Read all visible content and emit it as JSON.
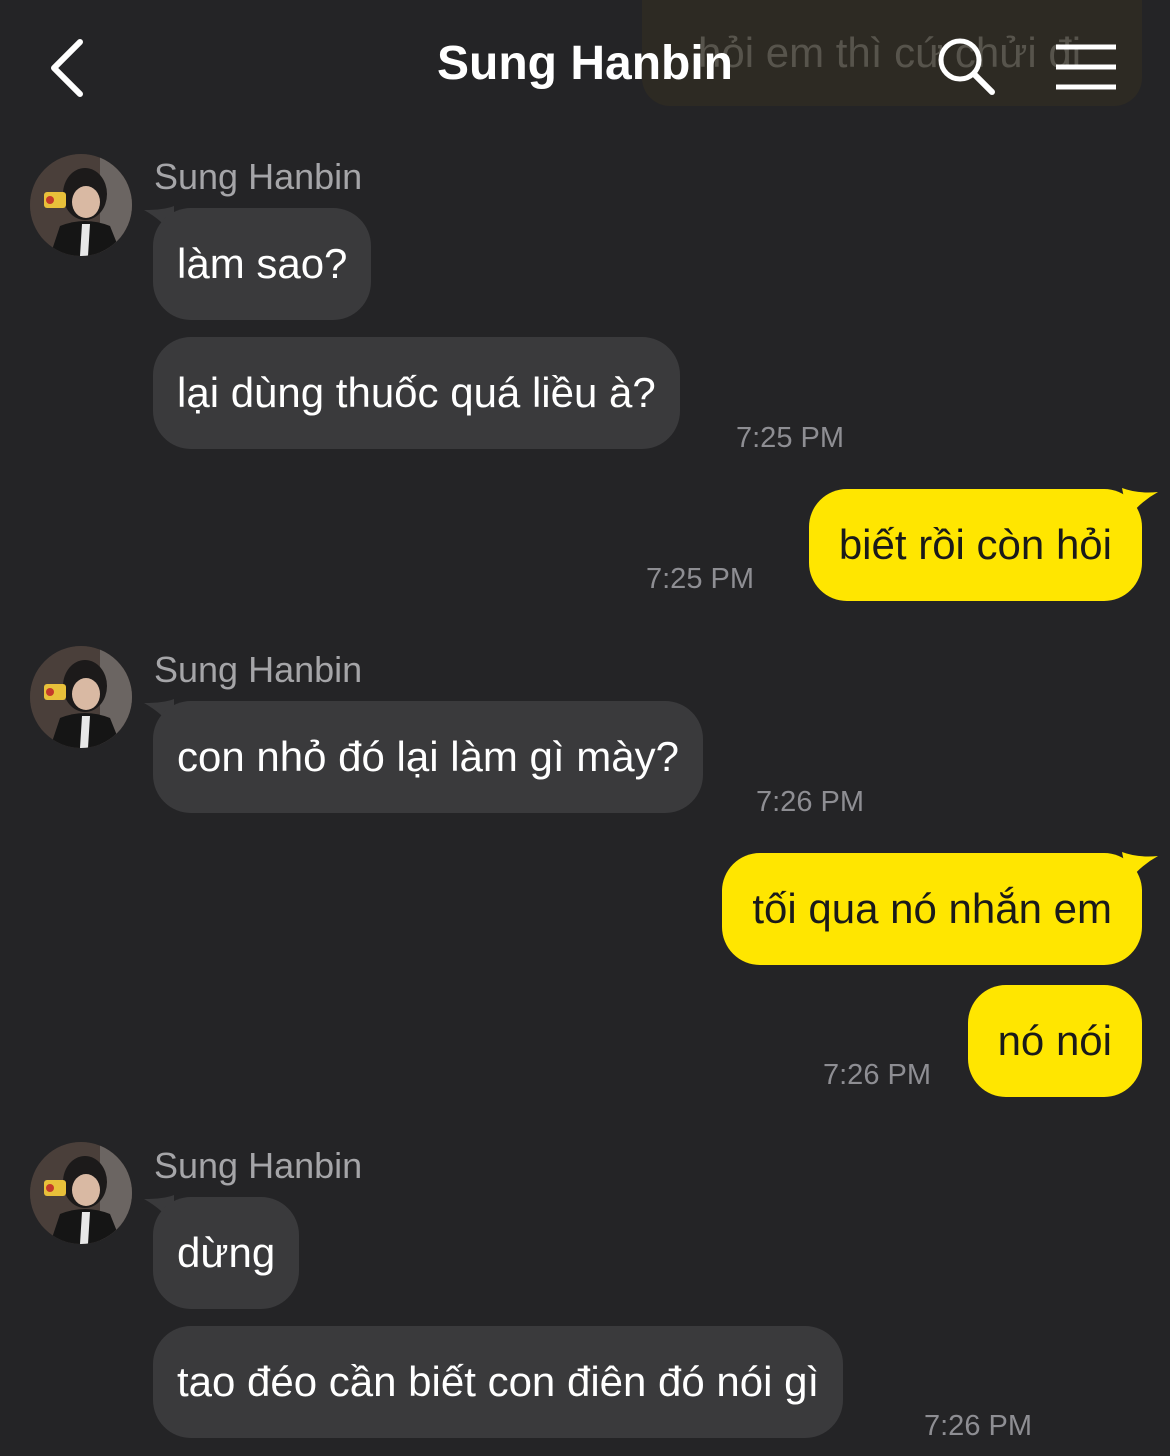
{
  "header": {
    "title": "Sung Hanbin",
    "ghost_text": "hỏi em thì cứ chửi đi"
  },
  "groups": [
    {
      "sender": "Sung Hanbin",
      "messages": [
        "làm sao?",
        "lại dùng thuốc quá liều à?"
      ],
      "time": "7:25 PM"
    },
    {
      "outgoing": [
        "biết rồi còn hỏi"
      ],
      "time": "7:25 PM"
    },
    {
      "sender": "Sung Hanbin",
      "messages": [
        "con nhỏ đó lại làm gì mày?"
      ],
      "time": "7:26 PM"
    },
    {
      "outgoing": [
        "tối qua nó nhắn em",
        "nó nói"
      ],
      "time": "7:26 PM"
    },
    {
      "sender": "Sung Hanbin",
      "messages": [
        "dừng",
        "tao đéo cần biết con điên đó nói gì"
      ],
      "time": "7:26 PM"
    }
  ],
  "colors": {
    "background": "#242426",
    "incoming_bubble": "#3a3a3c",
    "outgoing_bubble": "#ffe600"
  },
  "icons": [
    "back-icon",
    "search-icon",
    "menu-icon"
  ]
}
